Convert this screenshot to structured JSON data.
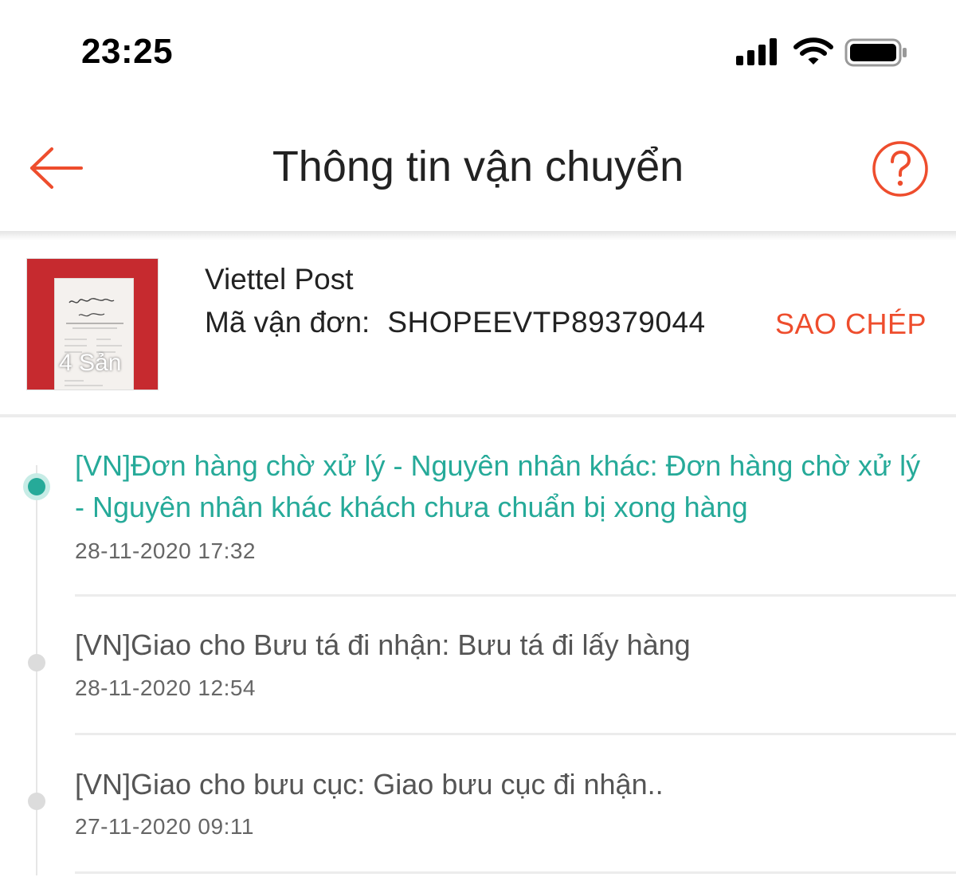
{
  "status_bar": {
    "time": "23:25",
    "icons": [
      "signal-icon",
      "wifi-icon",
      "battery-icon"
    ]
  },
  "header": {
    "title": "Thông tin vận chuyển",
    "back_icon": "arrow-left-icon",
    "help_icon": "question-circle-icon"
  },
  "shipment": {
    "thumbnail_count_label": "4 Sản",
    "carrier": "Viettel Post",
    "tracking_label": "Mã vận đơn:",
    "tracking_code": "SHOPEEVTP89379044",
    "copy_label": "SAO CHÉP"
  },
  "timeline": {
    "events": [
      {
        "text": "[VN]Đơn hàng chờ xử lý - Nguyên nhân khác: Đơn hàng chờ xử lý - Nguyên nhân khác khách chưa chuẩn bị xong hàng",
        "time": "28-11-2020 17:32",
        "active": true
      },
      {
        "text": "[VN]Giao cho Bưu tá đi nhận: Bưu tá đi lấy hàng",
        "time": "28-11-2020 12:54",
        "active": false
      },
      {
        "text": "[VN]Giao cho bưu cục: Giao bưu cục đi nhận..",
        "time": "27-11-2020 09:11",
        "active": false
      }
    ]
  },
  "colors": {
    "accent": "#ee4d2d",
    "active_event": "#26aa99",
    "product_bag": "#c62a2f"
  }
}
